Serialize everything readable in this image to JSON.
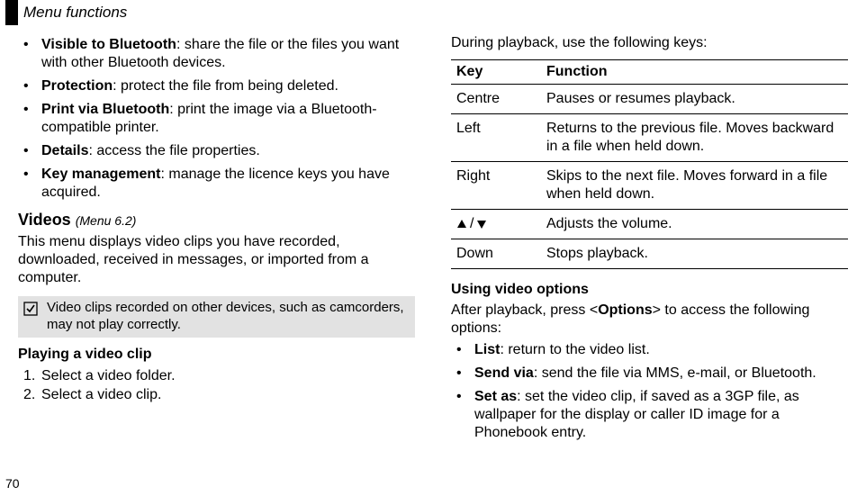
{
  "header": {
    "title": "Menu functions"
  },
  "left": {
    "bullets": [
      {
        "term": "Visible to Bluetooth",
        "desc": ": share the file or the files you want with other Bluetooth devices."
      },
      {
        "term": "Protection",
        "desc": ": protect the file from being deleted."
      },
      {
        "term": "Print via Bluetooth",
        "desc": ": print the image via a Bluetooth-compatible printer."
      },
      {
        "term": "Details",
        "desc": ": access the file properties."
      },
      {
        "term": "Key management",
        "desc": ": manage the licence keys you have acquired."
      }
    ],
    "videos_heading": "Videos",
    "videos_menu_ref": "(Menu 6.2)",
    "videos_para": "This menu displays video clips you have recorded, downloaded, received in messages, or imported from a computer.",
    "note": "Video clips recorded on other devices, such as camcorders, may not play correctly.",
    "playing_heading": "Playing a video clip",
    "steps": [
      {
        "n": "1.",
        "text": "Select a video folder."
      },
      {
        "n": "2.",
        "text": "Select a video clip."
      }
    ]
  },
  "right": {
    "intro": "During playback, use the following keys:",
    "table": {
      "head_key": "Key",
      "head_func": "Function",
      "rows": [
        {
          "key": "Centre",
          "func": "Pauses or resumes playback."
        },
        {
          "key": "Left",
          "func": "Returns to the previous file. Moves backward in a file when held down."
        },
        {
          "key": "Right",
          "func": "Skips to the next file. Moves forward in a file when held down."
        },
        {
          "key": "__VOL__",
          "func": "Adjusts the volume."
        },
        {
          "key": "Down",
          "func": "Stops playback."
        }
      ]
    },
    "using_heading": "Using video options",
    "after_playback_pre": "After playback, press <",
    "after_playback_bold": "Options",
    "after_playback_post": "> to access the following options:",
    "options": [
      {
        "term": "List",
        "desc": ": return to the video list."
      },
      {
        "term": "Send via",
        "desc": ": send the file via MMS, e-mail, or Bluetooth."
      },
      {
        "term": "Set as",
        "desc": ": set the video clip, if saved as a 3GP file, as wallpaper for the display or caller ID image for a Phonebook entry."
      }
    ]
  },
  "page_number": "70"
}
